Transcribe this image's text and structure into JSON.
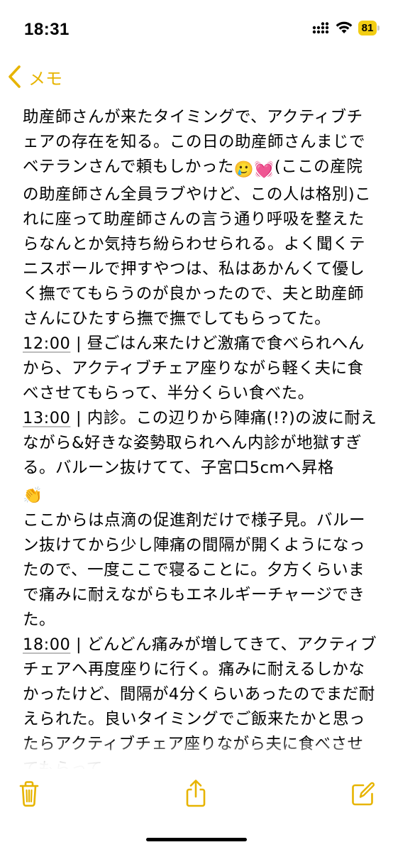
{
  "status_bar": {
    "time": "18:31",
    "battery_level": "81",
    "accent_color": "#f2cd13",
    "icons": [
      "signal-icon",
      "wifi-icon",
      "battery-icon"
    ]
  },
  "nav": {
    "back_label": "メモ",
    "accent_color": "#e7b400"
  },
  "note": {
    "p1": "助産師さんが来たタイミングで、アクティブチェアの存在を知る。この日の助産師さんまじでベテランさんで頼もしかった",
    "p1_emoji_a": "🥲",
    "p1_emoji_b": "💓",
    "p1_rest": "(ここの産院の助産師さん全員ラブやけど、この人は格別)これに座って助産師さんの言う通り呼吸を整えたらなんとか気持ち紛らわせられる。よく聞くテニスボールで押すやつは、私はあかんくて優しく撫でてもらうのが良かったので、夫と助産師さんにひたすら撫で撫でしてもらってた。",
    "t1": "12:00",
    "e1": " | 昼ごはん来たけど激痛で食べられへんから、アクティブチェア座りながら軽く夫に食べさせてもらって、半分くらい食べた。",
    "t2": "13:00",
    "e2": " | 内診。この辺りから陣痛(!?)の波に耐えながら&好きな姿勢取られへん内診が地獄すぎる。バルーン抜けてて、子宮口5cmへ昇格",
    "e2_emoji": "👏",
    "p2": "ここからは点滴の促進剤だけで様子見。バルーン抜けてから少し陣痛の間隔が開くようになったので、一度ここで寝ることに。夕方くらいまで痛みに耐えながらもエネルギーチャージできた。",
    "t3": "18:00",
    "e3": " | どんどん痛みが増してきて、アクティブチェアへ再度座りに行く。痛みに耐えるしかなかったけど、間隔が4分くらいあったのでまだ耐えられた。良いタイミングでご飯来たかと思ったらアクティブチェア座りながら夫に食べさせてもらって"
  },
  "toolbar": {
    "icons": [
      "trash-icon",
      "share-icon",
      "compose-icon"
    ],
    "icon_color": "#e7b400"
  }
}
